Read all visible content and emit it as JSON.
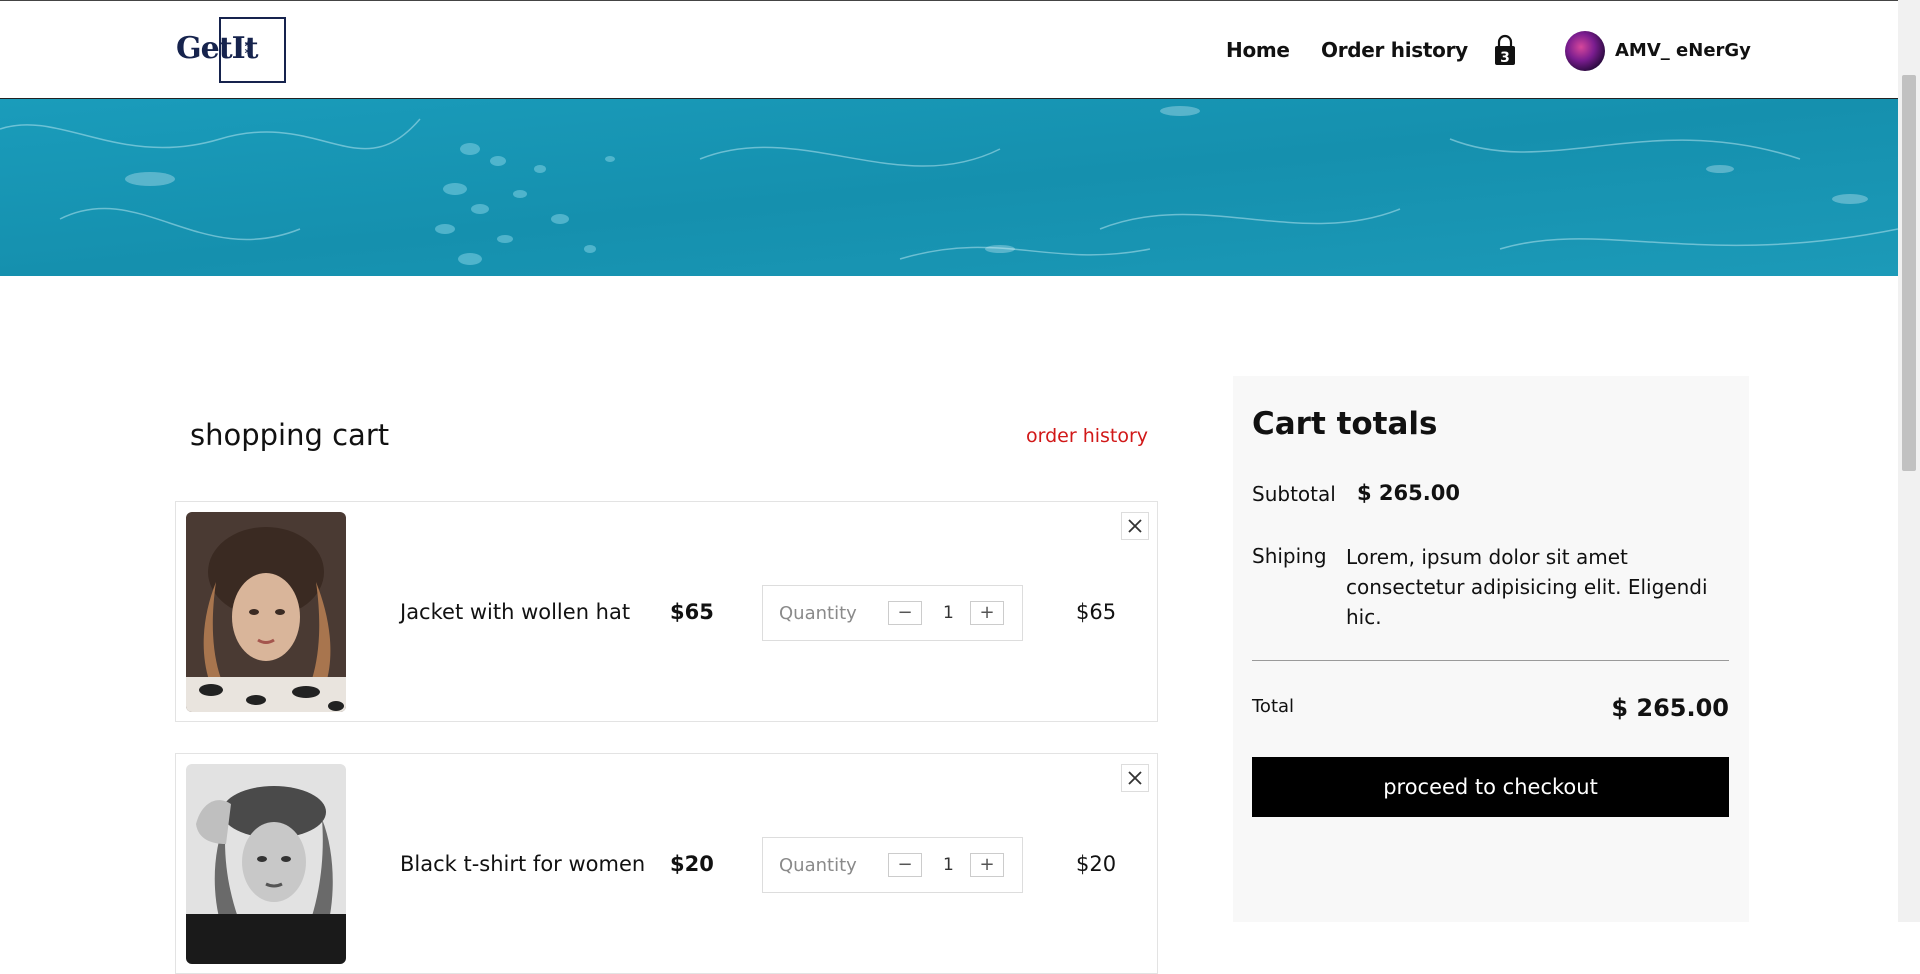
{
  "header": {
    "logo": "GetIt",
    "nav": [
      "Home",
      "Order history"
    ],
    "cart_count": "3",
    "user_name": "AMV_ eNerGy"
  },
  "cart": {
    "title": "shopping cart",
    "order_history_link": "order history",
    "quantity_label": "Quantity",
    "minus_symbol": "−",
    "plus_symbol": "+",
    "items": [
      {
        "name": "Jacket with wollen hat",
        "price": "$65",
        "quantity": "1",
        "total": "$65"
      },
      {
        "name": "Black t-shirt for women",
        "price": "$20",
        "quantity": "1",
        "total": "$20"
      }
    ]
  },
  "totals": {
    "title": "Cart totals",
    "subtotal_label": "Subtotal",
    "subtotal_value": "$ 265.00",
    "shipping_label": "Shiping",
    "shipping_text": "Lorem, ipsum dolor sit amet consectetur adipisicing elit. Eligendi hic.",
    "total_label": "Total",
    "total_value": "$ 265.00",
    "checkout_label": "proceed to checkout"
  },
  "colors": {
    "brand": "#16234d",
    "accent_link": "#d11818",
    "banner": "#1793b0",
    "checkout_bg": "#000000"
  }
}
